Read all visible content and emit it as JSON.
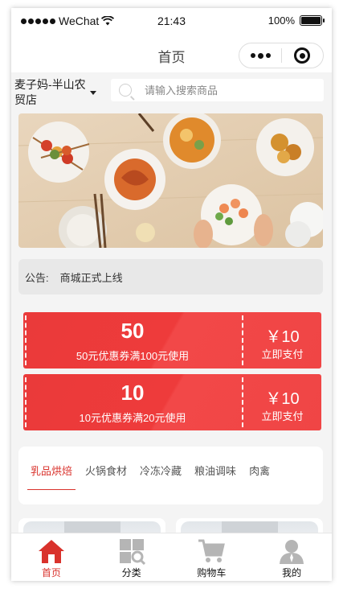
{
  "status_bar": {
    "carrier": "WeChat",
    "time": "21:43",
    "battery": "100%",
    "battery_level": 1.0
  },
  "nav": {
    "title": "首页"
  },
  "store": {
    "name": "麦子妈-半山农贸店"
  },
  "search": {
    "placeholder": "请输入搜索商品"
  },
  "notice": {
    "label": "公告:",
    "text": "商城正式上线"
  },
  "coupons": [
    {
      "amount": "50",
      "description": "50元优惠券满100元使用",
      "price": "￥10",
      "action": "立即支付"
    },
    {
      "amount": "10",
      "description": "10元优惠券满20元使用",
      "price": "￥10",
      "action": "立即支付"
    }
  ],
  "categories": [
    {
      "label": "乳品烘焙",
      "active": true
    },
    {
      "label": "火锅食材",
      "active": false
    },
    {
      "label": "冷冻冷藏",
      "active": false
    },
    {
      "label": "粮油调味",
      "active": false
    },
    {
      "label": "肉禽",
      "active": false
    }
  ],
  "tabbar": [
    {
      "label": "首页",
      "icon": "home-icon",
      "active": true
    },
    {
      "label": "分类",
      "icon": "category-icon",
      "active": false
    },
    {
      "label": "购物车",
      "icon": "cart-icon",
      "active": false
    },
    {
      "label": "我的",
      "icon": "user-icon",
      "active": false
    }
  ],
  "colors": {
    "accent": "#d9322c",
    "coupon": "#ee3b3b",
    "inactive_icon": "#b5b5b5"
  }
}
